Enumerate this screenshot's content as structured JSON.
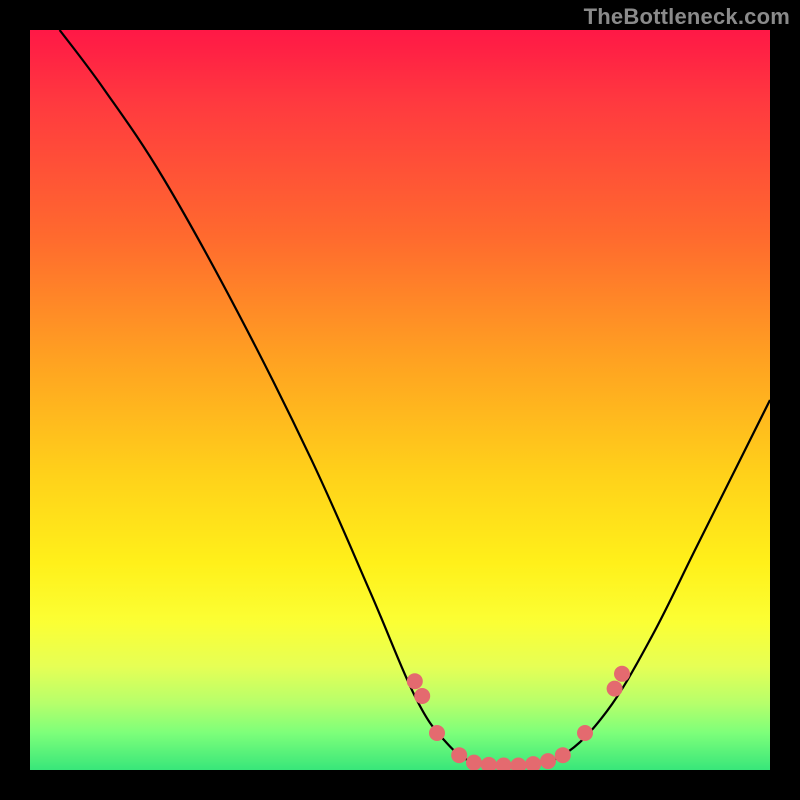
{
  "watermark": "TheBottleneck.com",
  "colors": {
    "page_bg": "#000000",
    "curve": "#000000",
    "dot": "#e46a6f",
    "gradient_stops": [
      "#ff1846",
      "#ff3a3f",
      "#ff6a2e",
      "#ffa321",
      "#ffd11a",
      "#fff01a",
      "#fbff34",
      "#e6ff55",
      "#b6ff6b",
      "#7dff7a",
      "#38e67a"
    ]
  },
  "chart_data": {
    "type": "line",
    "title": "",
    "xlabel": "",
    "ylabel": "",
    "xlim": [
      0,
      100
    ],
    "ylim": [
      0,
      100
    ],
    "grid": false,
    "legend": false,
    "curve": [
      {
        "x": 4,
        "y": 100
      },
      {
        "x": 10,
        "y": 92
      },
      {
        "x": 18,
        "y": 80
      },
      {
        "x": 28,
        "y": 62
      },
      {
        "x": 38,
        "y": 42
      },
      {
        "x": 46,
        "y": 24
      },
      {
        "x": 52,
        "y": 10
      },
      {
        "x": 56,
        "y": 4
      },
      {
        "x": 60,
        "y": 1
      },
      {
        "x": 66,
        "y": 0.6
      },
      {
        "x": 72,
        "y": 2
      },
      {
        "x": 78,
        "y": 8
      },
      {
        "x": 84,
        "y": 18
      },
      {
        "x": 90,
        "y": 30
      },
      {
        "x": 96,
        "y": 42
      },
      {
        "x": 100,
        "y": 50
      }
    ],
    "dots": [
      {
        "x": 52,
        "y": 12
      },
      {
        "x": 53,
        "y": 10
      },
      {
        "x": 55,
        "y": 5
      },
      {
        "x": 58,
        "y": 2
      },
      {
        "x": 60,
        "y": 1
      },
      {
        "x": 62,
        "y": 0.7
      },
      {
        "x": 64,
        "y": 0.6
      },
      {
        "x": 66,
        "y": 0.6
      },
      {
        "x": 68,
        "y": 0.8
      },
      {
        "x": 70,
        "y": 1.2
      },
      {
        "x": 72,
        "y": 2
      },
      {
        "x": 75,
        "y": 5
      },
      {
        "x": 79,
        "y": 11
      },
      {
        "x": 80,
        "y": 13
      }
    ]
  }
}
